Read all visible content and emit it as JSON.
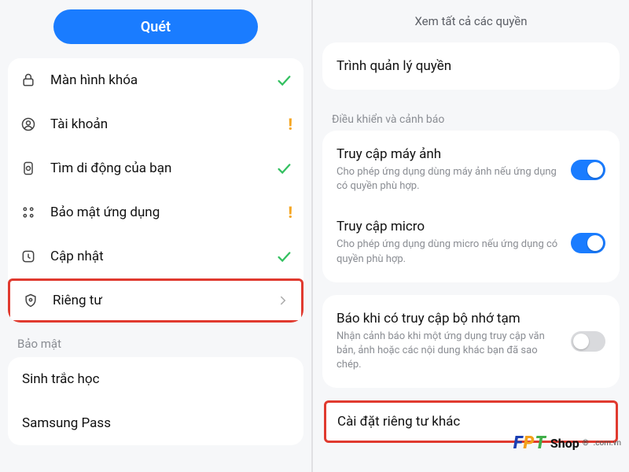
{
  "left": {
    "scan_label": "Quét",
    "items": [
      {
        "icon": "lock-icon",
        "label": "Màn hình khóa",
        "trail": "check"
      },
      {
        "icon": "user-circle-icon",
        "label": "Tài khoản",
        "trail": "warn"
      },
      {
        "icon": "find-phone-icon",
        "label": "Tìm di động của bạn",
        "trail": "check"
      },
      {
        "icon": "app-grid-icon",
        "label": "Bảo mật ứng dụng",
        "trail": "warn"
      },
      {
        "icon": "update-icon",
        "label": "Cập nhật",
        "trail": "check"
      },
      {
        "icon": "shield-icon",
        "label": "Riêng tư",
        "trail": "chev",
        "highlight": true
      }
    ],
    "section2_header": "Bảo mật",
    "items2": [
      {
        "label": "Sinh trắc học"
      },
      {
        "label": "Samsung Pass"
      }
    ]
  },
  "right": {
    "top_link": "Xem tất cả các quyền",
    "card1": {
      "title": "Trình quản lý quyền"
    },
    "section_header": "Điều khiển và cảnh báo",
    "card2": [
      {
        "title": "Truy cập máy ảnh",
        "sub": "Cho phép ứng dụng dùng máy ảnh nếu ứng dụng có quyền phù hợp.",
        "switch": "on"
      },
      {
        "title": "Truy cập micro",
        "sub": "Cho phép ứng dụng dùng micro nếu ứng dụng có quyền phù hợp.",
        "switch": "on"
      }
    ],
    "card3": [
      {
        "title": "Báo khi có truy cập bộ nhớ tạm",
        "sub": "Nhận cảnh báo khi một ứng dụng truy cập văn bản, ảnh hoặc các nội dung khác bạn đã sao chép.",
        "switch": "off"
      }
    ],
    "other_settings": {
      "title": "Cài đặt riêng tư khác"
    }
  },
  "watermark": {
    "f": "F",
    "p": "P",
    "t": "T",
    "suffix": "Shop",
    "sub": ".com.vn",
    "reg": "®"
  }
}
